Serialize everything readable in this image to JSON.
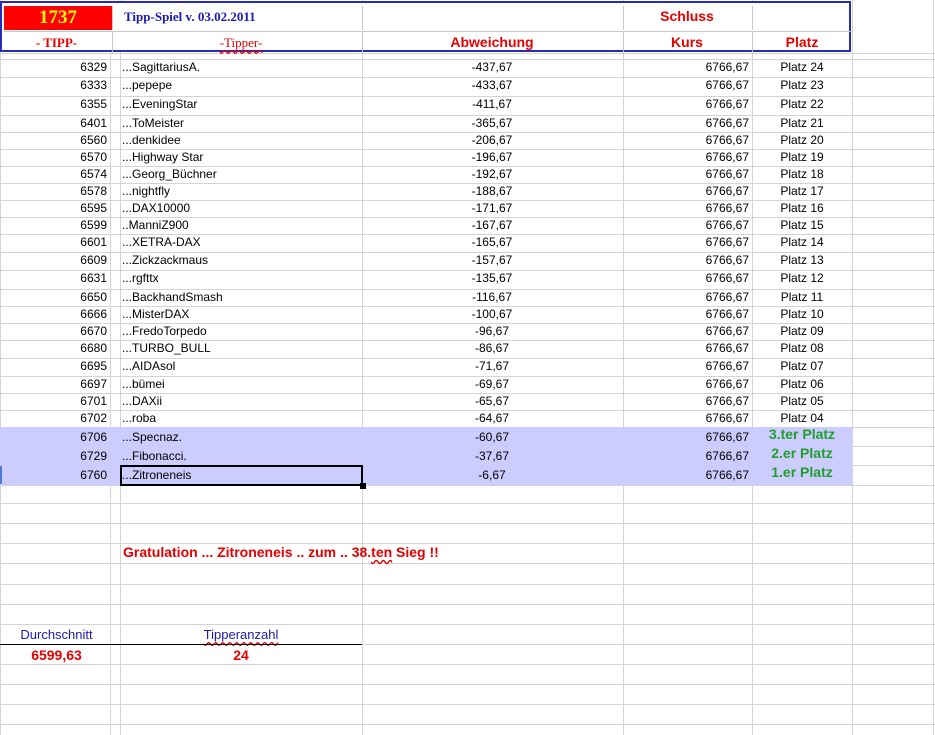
{
  "header": {
    "code": "1737",
    "title": "Tipp-Spiel v. 03.02.2011",
    "schluss": "Schluss",
    "col_tipp": "- TIPP-",
    "col_tipper": "-Tipper-",
    "col_abweichung": "Abweichung",
    "col_kurs": "Kurs",
    "col_platz": "Platz"
  },
  "rows": [
    {
      "tipp": "6329",
      "name": "...SagittariusA.",
      "abw": "-437,67",
      "kurs": "6766,67",
      "platz": "Platz 24"
    },
    {
      "tipp": "6333",
      "name": "...pepepe",
      "abw": "-433,67",
      "kurs": "6766,67",
      "platz": "Platz 23"
    },
    {
      "tipp": "6355",
      "name": "...EveningStar",
      "abw": "-411,67",
      "kurs": "6766,67",
      "platz": "Platz 22"
    },
    {
      "tipp": "6401",
      "name": "...ToMeister",
      "abw": "-365,67",
      "kurs": "6766,67",
      "platz": "Platz 21"
    },
    {
      "tipp": "6560",
      "name": "...denkidee",
      "abw": "-206,67",
      "kurs": "6766,67",
      "platz": "Platz 20"
    },
    {
      "tipp": "6570",
      "name": "...Highway Star",
      "abw": "-196,67",
      "kurs": "6766,67",
      "platz": "Platz 19"
    },
    {
      "tipp": "6574",
      "name": "...Georg_Büchner",
      "abw": "-192,67",
      "kurs": "6766,67",
      "platz": "Platz 18"
    },
    {
      "tipp": "6578",
      "name": "...nightfly",
      "abw": "-188,67",
      "kurs": "6766,67",
      "platz": "Platz 17"
    },
    {
      "tipp": "6595",
      "name": "...DAX10000",
      "abw": "-171,67",
      "kurs": "6766,67",
      "platz": "Platz 16"
    },
    {
      "tipp": "6599",
      "name": "..ManniZ900",
      "abw": "-167,67",
      "kurs": "6766,67",
      "platz": "Platz 15"
    },
    {
      "tipp": "6601",
      "name": "...XETRA-DAX",
      "abw": "-165,67",
      "kurs": "6766,67",
      "platz": "Platz 14"
    },
    {
      "tipp": "6609",
      "name": "...Zickzackmaus",
      "abw": "-157,67",
      "kurs": "6766,67",
      "platz": "Platz 13"
    },
    {
      "tipp": "6631",
      "name": "...rgfttx",
      "abw": "-135,67",
      "kurs": "6766,67",
      "platz": "Platz 12"
    },
    {
      "tipp": "6650",
      "name": "...BackhandSmash",
      "abw": "-116,67",
      "kurs": "6766,67",
      "platz": "Platz 11"
    },
    {
      "tipp": "6666",
      "name": "...MisterDAX",
      "abw": "-100,67",
      "kurs": "6766,67",
      "platz": "Platz 10"
    },
    {
      "tipp": "6670",
      "name": "...FredoTorpedo",
      "abw": "-96,67",
      "kurs": "6766,67",
      "platz": "Platz 09"
    },
    {
      "tipp": "6680",
      "name": "...TURBO_BULL",
      "abw": "-86,67",
      "kurs": "6766,67",
      "platz": "Platz 08"
    },
    {
      "tipp": "6695",
      "name": "...AIDAsol",
      "abw": "-71,67",
      "kurs": "6766,67",
      "platz": "Platz 07"
    },
    {
      "tipp": "6697",
      "name": "...bümei",
      "abw": "-69,67",
      "kurs": "6766,67",
      "platz": "Platz 06"
    },
    {
      "tipp": "6701",
      "name": "...DAXii",
      "abw": "-65,67",
      "kurs": "6766,67",
      "platz": "Platz 05"
    },
    {
      "tipp": "6702",
      "name": "...roba",
      "abw": "-64,67",
      "kurs": "6766,67",
      "platz": "Platz 04"
    },
    {
      "tipp": "6706",
      "name": "...Specnaz.",
      "abw": "-60,67",
      "kurs": "6766,67",
      "platz": "3.ter Platz"
    },
    {
      "tipp": "6729",
      "name": "...Fibonacci.",
      "abw": "-37,67",
      "kurs": "6766,67",
      "platz": "2.er Platz"
    },
    {
      "tipp": "6760",
      "name": "...Zitroneneis",
      "abw": "-6,67",
      "kurs": "6766,67",
      "platz": "1.er Platz"
    }
  ],
  "message": {
    "p1": "Gratulation ...  Zitroneneis  .. zum .. 38.",
    "p2": "ten",
    "p3": " Sieg !!"
  },
  "summary": {
    "durchschnitt_label": "Durchschnitt",
    "durchschnitt_value": "6599,63",
    "tipperanzahl_label": "Tipperanzahl",
    "tipperanzahl_value": "24"
  }
}
